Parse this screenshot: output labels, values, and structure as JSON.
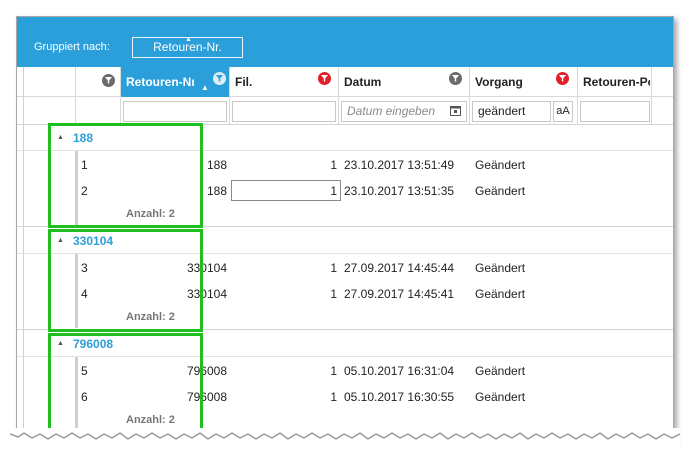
{
  "group_bar": {
    "label": "Gruppiert nach:",
    "chip": "Retouren-Nr."
  },
  "columns": [
    {
      "key": "retouren_nr",
      "label": "Retouren-Nı",
      "filter": "none",
      "active": true
    },
    {
      "key": "fil",
      "label": "Fil.",
      "filter": "active"
    },
    {
      "key": "datum",
      "label": "Datum",
      "filter": "none"
    },
    {
      "key": "vorgang",
      "label": "Vorgang",
      "filter": "active"
    },
    {
      "key": "retouren_pos",
      "label": "Retouren-Pc",
      "filter": "none"
    }
  ],
  "filters": {
    "datum_placeholder": "Datum eingeben",
    "vorgang_value": "geändert",
    "case_toggle": "aA"
  },
  "colors": {
    "accent": "#2b9fd9",
    "filter_active": "#e0202a",
    "highlight": "#1fbf1f"
  },
  "groups": [
    {
      "value": "188",
      "rows": [
        {
          "pos": "1",
          "nr": "188",
          "fil": "1",
          "datum": "23.10.2017 13:51:49",
          "vorgang": "Geändert"
        },
        {
          "pos": "2",
          "nr": "188",
          "fil": "1",
          "datum": "23.10.2017 13:51:35",
          "vorgang": "Geändert"
        }
      ],
      "count": "Anzahl: 2"
    },
    {
      "value": "330104",
      "rows": [
        {
          "pos": "3",
          "nr": "330104",
          "fil": "1",
          "datum": "27.09.2017 14:45:44",
          "vorgang": "Geändert"
        },
        {
          "pos": "4",
          "nr": "330104",
          "fil": "1",
          "datum": "27.09.2017 14:45:41",
          "vorgang": "Geändert"
        }
      ],
      "count": "Anzahl: 2"
    },
    {
      "value": "796008",
      "rows": [
        {
          "pos": "5",
          "nr": "796008",
          "fil": "1",
          "datum": "05.10.2017 16:31:04",
          "vorgang": "Geändert"
        },
        {
          "pos": "6",
          "nr": "796008",
          "fil": "1",
          "datum": "05.10.2017 16:30:55",
          "vorgang": "Geändert"
        }
      ],
      "count": "Anzahl: 2"
    }
  ]
}
